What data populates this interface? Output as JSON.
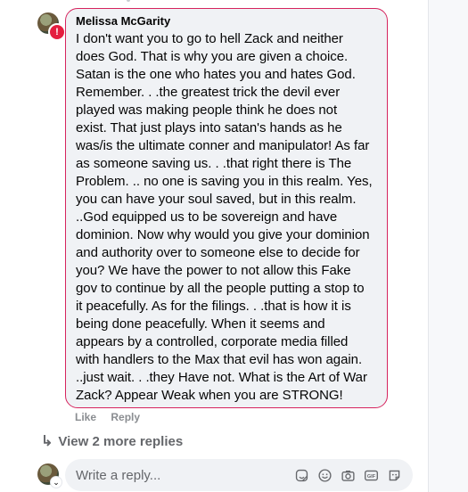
{
  "comment": {
    "author": "Melissa McGarity",
    "error_badge": "!",
    "text": "I don't want you to go to hell Zack and neither\ndoes God. That is why you are given a choice.\nSatan is the one who hates you and hates God.\nRemember. . .the greatest trick the devil ever\nplayed was making people think he does not\nexist. That just plays into satan's hands as he\nwas/is the ultimate conner and manipulator! As far\nas someone saving us. . .that right there is The\nProblem. .. no one is saving you in this realm. Yes,\nyou can have your soul saved, but in this realm.\n..God equipped us to be sovereign and have\ndominion. Now why would you give your dominion\nand authority over to someone else to decide for\nyou? We have the power to not allow this Fake\ngov to continue by all the people putting a stop to\nit peacefully. As for the filings. . .that is how it is\nbeing done peacefully. When it seems and\nappears by a controlled, corporate media filled\nwith handlers to the Max that evil has won again.\n..just wait. . .they Have not. What is the Art of War\nZack? Appear Weak when you are STRONG!",
    "actions": {
      "like": "Like",
      "reply": "Reply"
    }
  },
  "more_replies": {
    "label": "View 2 more replies"
  },
  "reply_box": {
    "placeholder": "Write a reply...",
    "tools": [
      "sticker-icon",
      "emoji-icon",
      "camera-icon",
      "gif-icon",
      "avatar-sticker-icon"
    ]
  },
  "colors": {
    "bubble_border": "#d6245e",
    "bubble_bg": "#f0f2f5",
    "muted_text": "#65676b"
  }
}
